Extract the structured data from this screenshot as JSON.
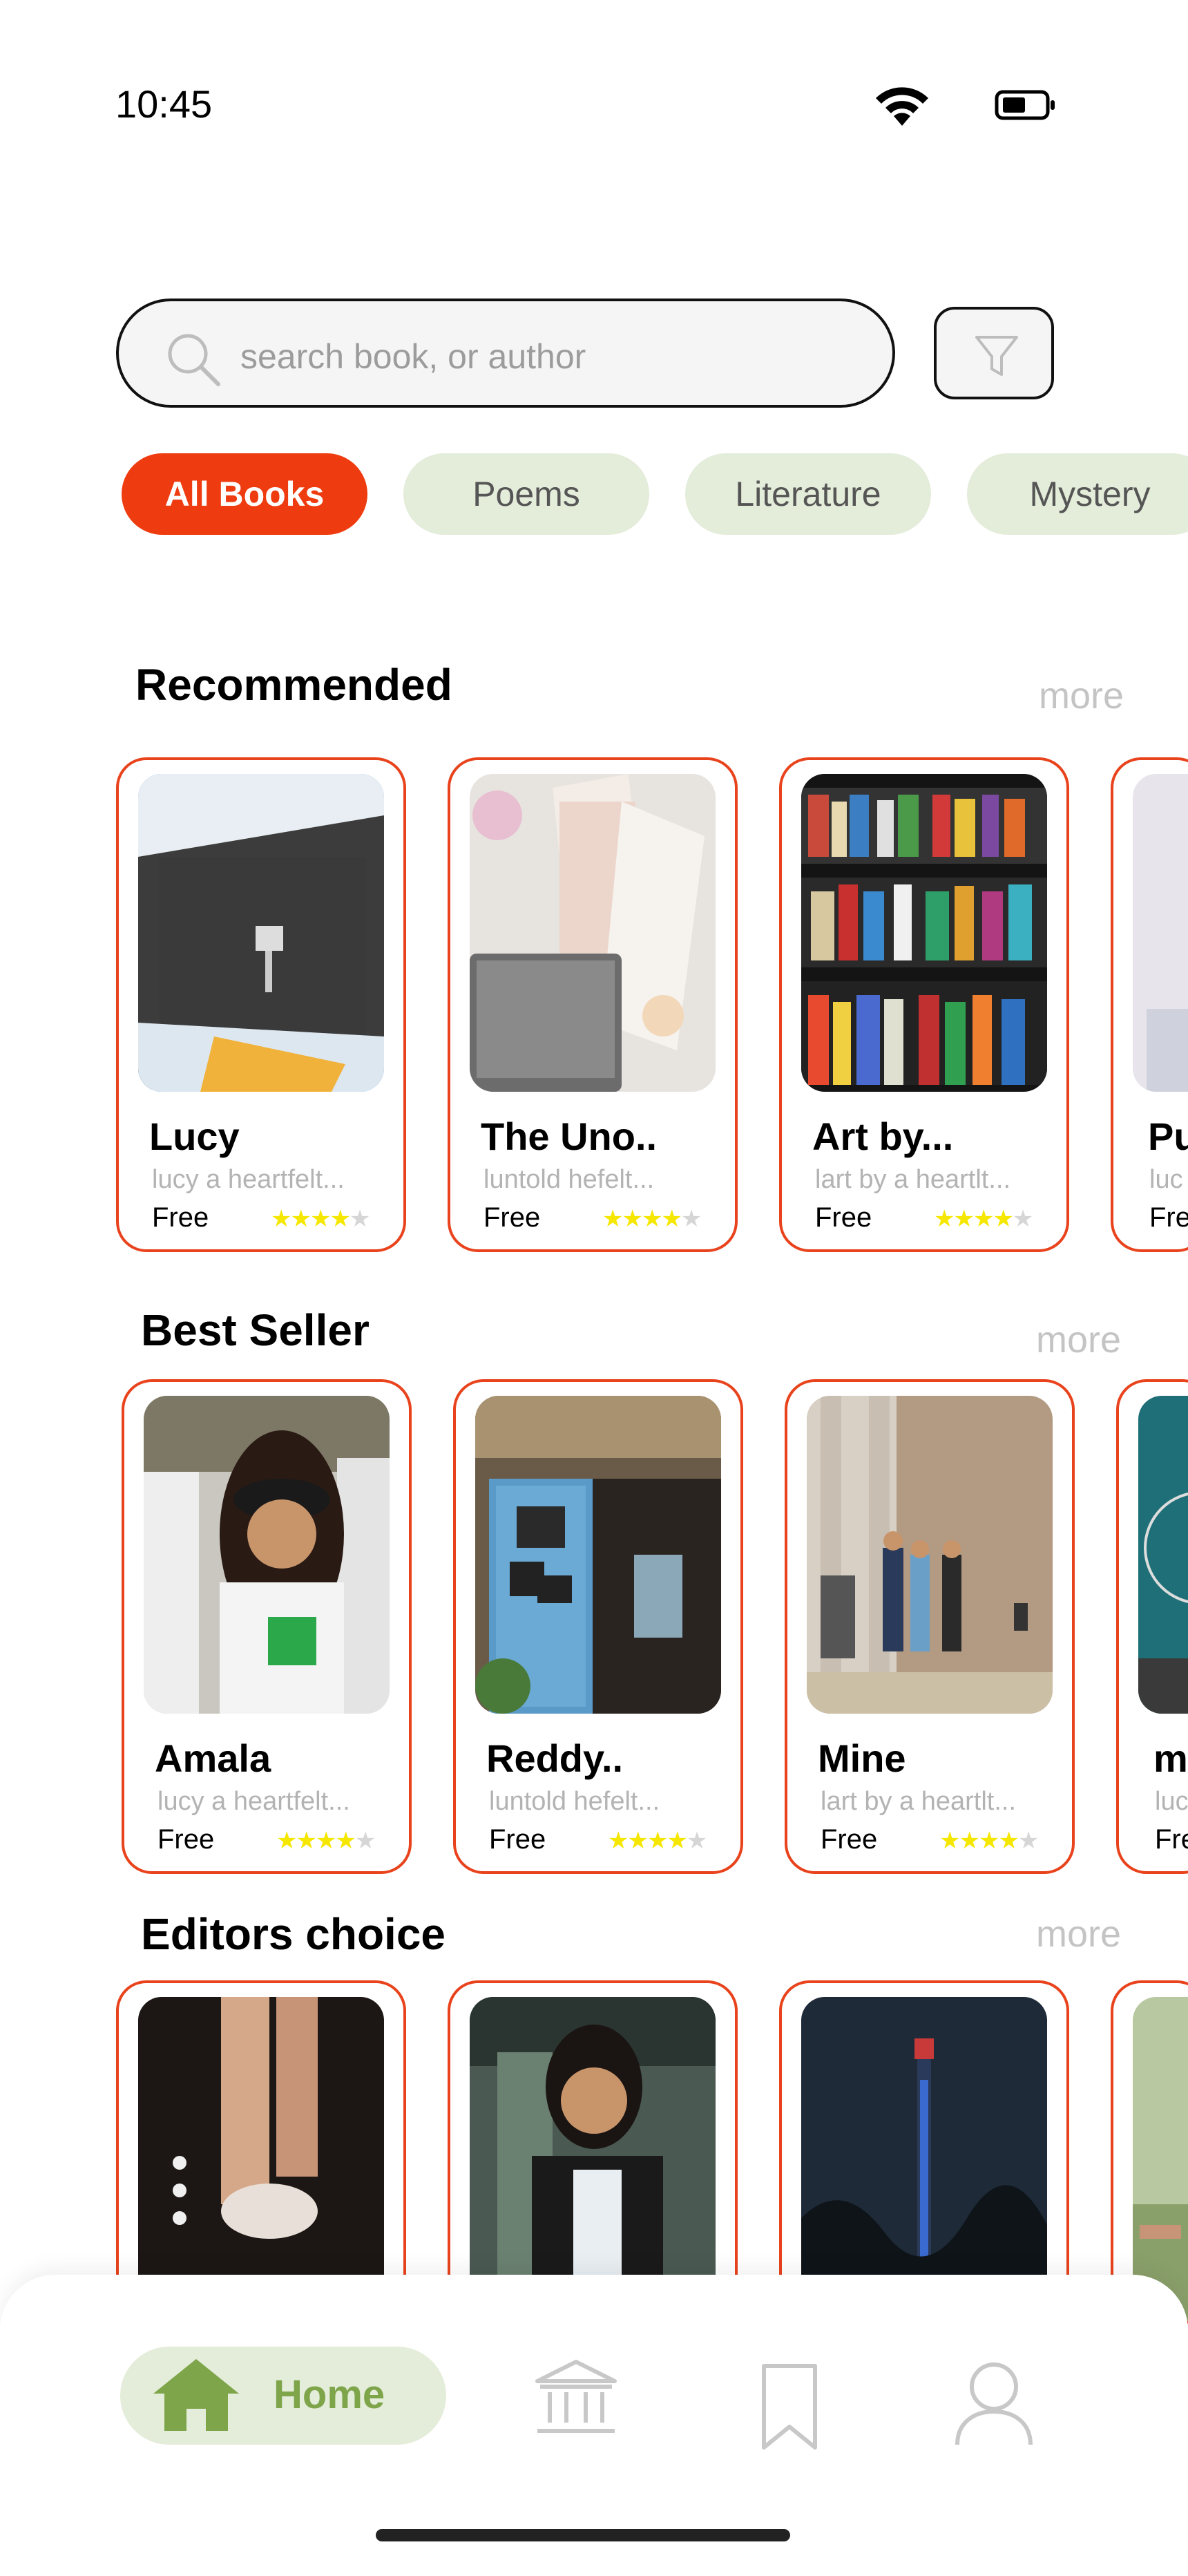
{
  "status_bar": {
    "time": "10:45",
    "wifi_icon": "wifi-icon",
    "battery_icon": "battery-icon"
  },
  "search": {
    "placeholder": "search book, or author",
    "icon": "search-icon",
    "filter_icon": "filter-icon"
  },
  "categories": [
    {
      "label": "All Books",
      "active": true
    },
    {
      "label": "Poems",
      "active": false
    },
    {
      "label": "Literature",
      "active": false
    },
    {
      "label": "Mystery",
      "active": false
    }
  ],
  "sections": [
    {
      "title": "Recommended",
      "more": "more",
      "books": [
        {
          "title": "Lucy",
          "subtitle": "lucy a heartfelt...",
          "price": "Free",
          "rating": 4
        },
        {
          "title": "The Uno..",
          "subtitle": "luntold  hefelt...",
          "price": "Free",
          "rating": 4
        },
        {
          "title": "Art by...",
          "subtitle": "lart by a heartlt...",
          "price": "Free",
          "rating": 4
        },
        {
          "title": "Pu",
          "subtitle": "luc",
          "price": "Fre",
          "rating": 0
        }
      ]
    },
    {
      "title": "Best Seller",
      "more": "more",
      "books": [
        {
          "title": "Amala",
          "subtitle": "lucy a heartfelt...",
          "price": "Free",
          "rating": 4
        },
        {
          "title": "Reddy..",
          "subtitle": "luntold  hefelt...",
          "price": "Free",
          "rating": 4
        },
        {
          "title": "Mine",
          "subtitle": "lart by a heartlt...",
          "price": "Free",
          "rating": 4
        },
        {
          "title": "m",
          "subtitle": "luc",
          "price": "Fre",
          "rating": 0
        }
      ]
    },
    {
      "title": "Editors choice",
      "more": "more",
      "books": [
        {
          "title": "",
          "subtitle": "",
          "price": "",
          "rating": 0
        },
        {
          "title": "",
          "subtitle": "",
          "price": "",
          "rating": 0
        },
        {
          "title": "",
          "subtitle": "",
          "price": "",
          "rating": 0
        },
        {
          "title": "",
          "subtitle": "",
          "price": "",
          "rating": 0
        }
      ]
    }
  ],
  "bottom_nav": {
    "home_label": "Home",
    "icons": [
      "home-icon",
      "library-icon",
      "bookmark-icon",
      "profile-icon"
    ],
    "active_color": "#7ea54a",
    "inactive_color": "#c8c8c8"
  },
  "colors": {
    "accent": "#ee3b0f",
    "chip_bg": "#e4ecda",
    "card_border": "#e8431c",
    "star": "#f5e700"
  }
}
